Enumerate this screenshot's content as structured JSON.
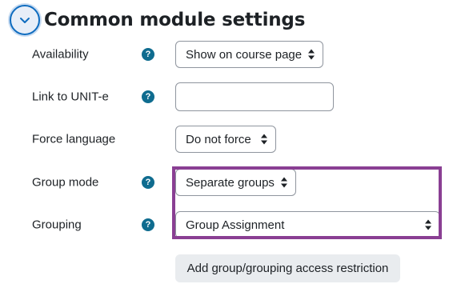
{
  "section": {
    "title": "Common module settings",
    "toggle_icon": "chevron-down-icon"
  },
  "fields": {
    "availability": {
      "label": "Availability",
      "value": "Show on course page",
      "has_help": true
    },
    "link_to_unit": {
      "label": "Link to UNIT-e",
      "value": "",
      "has_help": true
    },
    "force_language": {
      "label": "Force language",
      "value": "Do not force",
      "has_help": false
    },
    "group_mode": {
      "label": "Group mode",
      "value": "Separate groups",
      "has_help": true
    },
    "grouping": {
      "label": "Grouping",
      "value": "Group Assignment",
      "has_help": true
    }
  },
  "help_icon_glyph": "?",
  "buttons": {
    "add_restriction": "Add group/grouping access restriction"
  },
  "colors": {
    "accent": "#0f6cbf",
    "help_icon": "#0f6c8f",
    "highlight": "#8a3f93"
  }
}
